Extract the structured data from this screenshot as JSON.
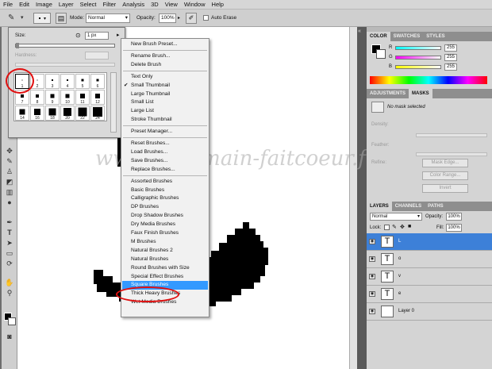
{
  "menubar": [
    "File",
    "Edit",
    "Image",
    "Layer",
    "Select",
    "Filter",
    "Analysis",
    "3D",
    "View",
    "Window",
    "Help"
  ],
  "options": {
    "mode_label": "Mode:",
    "mode_value": "Normal",
    "opacity_label": "Opacity:",
    "opacity_value": "100%",
    "auto_erase_label": "Auto Erase"
  },
  "brush_picker": {
    "size_label": "Size:",
    "size_value": "1 px",
    "hardness_label": "Hardness:",
    "brushes": [
      "1",
      "2",
      "3",
      "4",
      "5",
      "6",
      "7",
      "8",
      "9",
      "10",
      "11",
      "12",
      "14",
      "16",
      "18",
      "20",
      "22",
      "24"
    ]
  },
  "menu": {
    "group1": [
      "New Brush Preset..."
    ],
    "group2": [
      "Rename Brush...",
      "Delete Brush"
    ],
    "group3": [
      "Text Only",
      "Small Thumbnail",
      "Large Thumbnail",
      "Small List",
      "Large List",
      "Stroke Thumbnail"
    ],
    "checked_item": "Small Thumbnail",
    "group4": [
      "Preset Manager..."
    ],
    "group5": [
      "Reset Brushes...",
      "Load Brushes...",
      "Save Brushes...",
      "Replace Brushes..."
    ],
    "group6": [
      "Assorted Brushes",
      "Basic Brushes",
      "Calligraphic Brushes",
      "DP Brushes",
      "Drop Shadow Brushes",
      "Dry Media Brushes",
      "Faux Finish Brushes",
      "M Brushes",
      "Natural Brushes 2",
      "Natural Brushes",
      "Round Brushes with Size",
      "Special Effect Brushes",
      "Square Brushes",
      "Thick Heavy Brushes",
      "Wet Media Brushes"
    ],
    "highlighted_item": "Square Brushes"
  },
  "watermark": "www.petitmain-faitcoeur.fr",
  "color_panel": {
    "tabs": [
      "COLOR",
      "SWATCHES",
      "STYLES"
    ],
    "labels": [
      "R",
      "G",
      "B"
    ],
    "values": [
      "255",
      "255",
      "255"
    ]
  },
  "adjustments_panel": {
    "tabs": [
      "ADJUSTMENTS",
      "MASKS"
    ],
    "mask_text": "No mask selected",
    "density_label": "Density:",
    "feather_label": "Feather:",
    "refine_label": "Refine:",
    "buttons": [
      "Mask Edge...",
      "Color Range...",
      "Invert"
    ]
  },
  "layers_panel": {
    "tabs": [
      "LAYERS",
      "CHANNELS",
      "PATHS"
    ],
    "blend_mode": "Normal",
    "opacity_label": "Opacity:",
    "opacity_value": "100%",
    "lock_label": "Lock:",
    "fill_label": "Fill:",
    "fill_value": "100%",
    "layers": [
      {
        "name": "L",
        "type": "T"
      },
      {
        "name": "o",
        "type": "T"
      },
      {
        "name": "v",
        "type": "T"
      },
      {
        "name": "e",
        "type": "T"
      },
      {
        "name": "Layer 0",
        "type": ""
      }
    ]
  },
  "colors": {
    "highlight": "#3399ff",
    "layer_selected": "#3d80d8",
    "circle": "#e01010"
  }
}
